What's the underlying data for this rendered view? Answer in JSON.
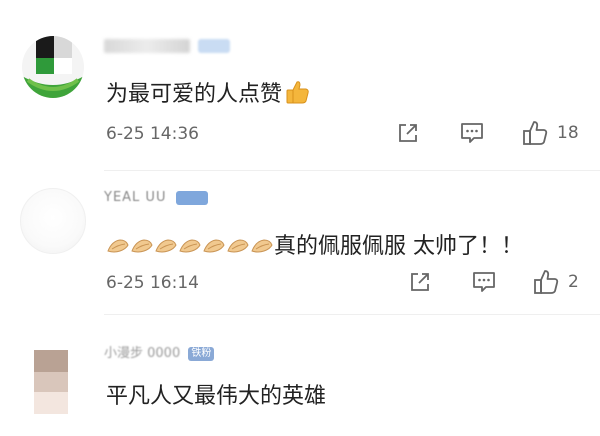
{
  "comments": [
    {
      "text": "为最可爱的人点赞",
      "emoji": "thumbs-up-emoji",
      "time": "6-25 14:36",
      "likes": "18",
      "badge_color": "#8fb6e8"
    },
    {
      "nickname_visible": "YEAL UU",
      "text": "真的佩服佩服 太帅了！！",
      "emoji": "praying-hands-emoji",
      "emoji_count": 7,
      "time": "6-25 16:14",
      "likes": "2",
      "badge_color": "#7fa7dc"
    },
    {
      "nickname_visible": "小漫步 0000",
      "badge_label": "铁粉",
      "text": "平凡人又最伟大的英雄",
      "badge_color": "#8aa9d6"
    }
  ],
  "icons": {
    "share": "share-icon",
    "comment": "comment-icon",
    "like": "thumbs-up-icon"
  },
  "colors": {
    "text": "#222222",
    "meta": "#666666",
    "badge": "#8fb6e8"
  }
}
